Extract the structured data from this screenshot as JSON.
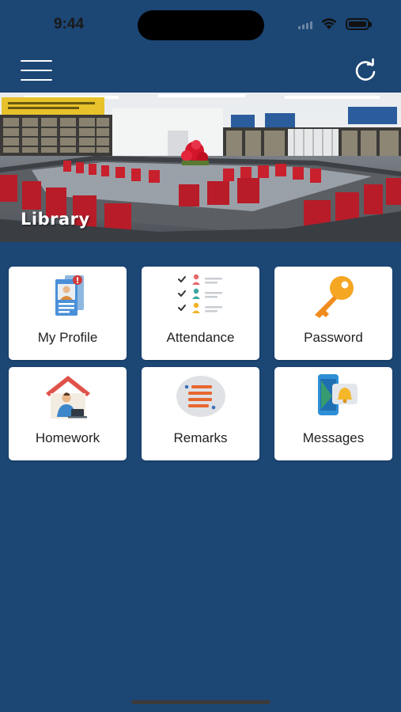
{
  "status_bar": {
    "time": "9:44"
  },
  "header": {
    "menu_icon": "hamburger-menu-icon",
    "refresh_icon": "refresh-icon"
  },
  "banner": {
    "label": "Library"
  },
  "tiles": [
    {
      "label": "My Profile",
      "icon": "profile-card-icon"
    },
    {
      "label": "Attendance",
      "icon": "attendance-checklist-icon"
    },
    {
      "label": "Password",
      "icon": "key-icon"
    },
    {
      "label": "Homework",
      "icon": "homework-house-icon"
    },
    {
      "label": "Remarks",
      "icon": "remarks-icon"
    },
    {
      "label": "Messages",
      "icon": "messages-phone-bell-icon"
    }
  ],
  "colors": {
    "background": "#1c4674",
    "tile": "#ffffff",
    "chair_red": "#c8202c",
    "key_orange": "#f5a623"
  }
}
